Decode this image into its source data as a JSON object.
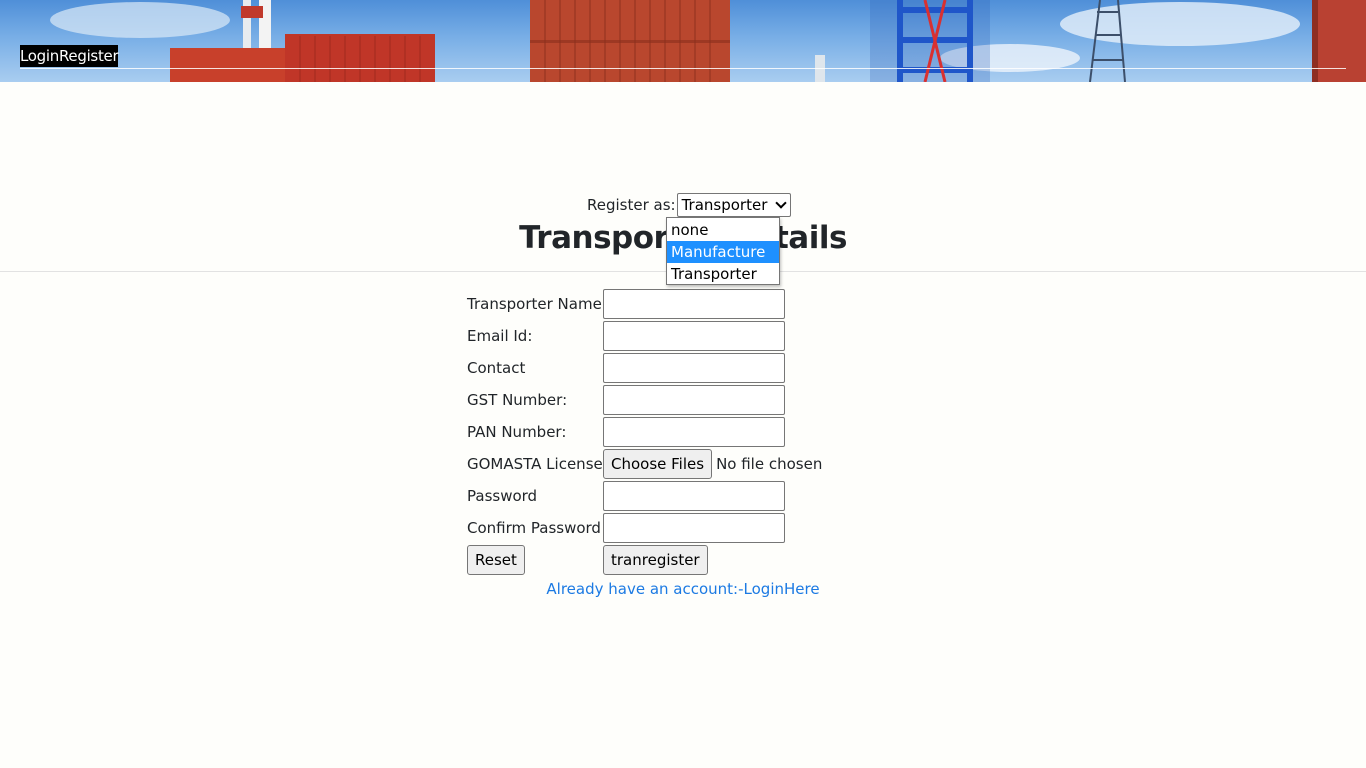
{
  "nav": {
    "login": "Login",
    "register": "Register"
  },
  "register_as": {
    "label": "Register as:",
    "selected": "Transporter",
    "options": [
      "none",
      "Manufacture",
      "Transporter"
    ],
    "highlighted": "Manufacture"
  },
  "heading": "Transporter Details",
  "form": {
    "name_label": "Transporter Name:",
    "email_label": "Email Id:",
    "contact_label": "Contact",
    "gst_label": "GST Number:",
    "pan_label": "PAN Number:",
    "gomasta_label": "GOMASTA License:",
    "choose_files": "Choose Files",
    "file_status": "No file chosen",
    "password_label": "Password",
    "confirm_label": "Confirm Password",
    "reset": "Reset",
    "submit": "tranregister",
    "login_link": "Already have an account:-LoginHere"
  },
  "colors": {
    "highlight": "#1e90ff",
    "link": "#1c7ae3",
    "page_bg": "#fefefb"
  }
}
